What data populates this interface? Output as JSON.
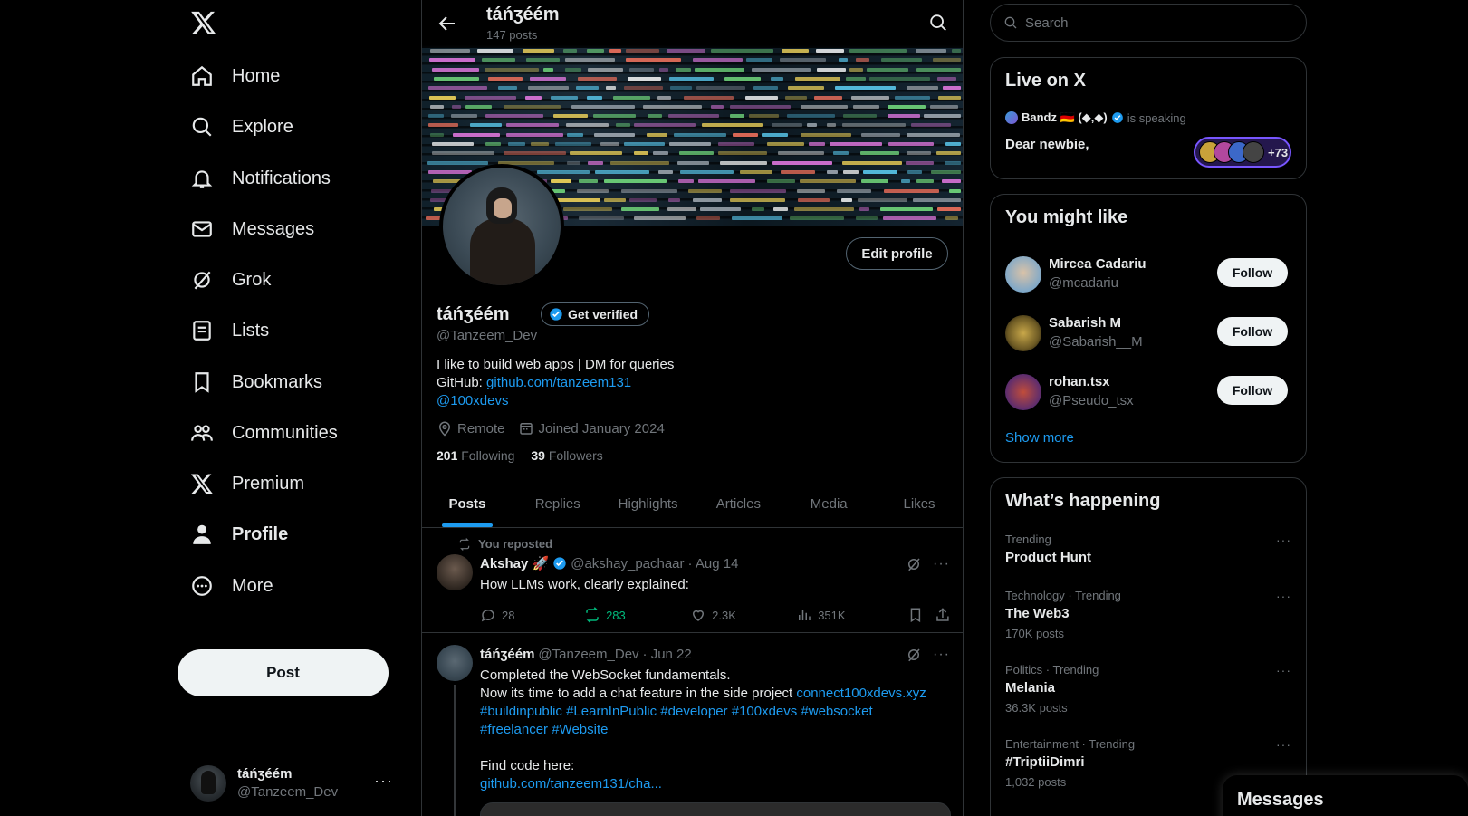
{
  "nav": {
    "items": [
      {
        "label": "Home",
        "icon": "home-icon"
      },
      {
        "label": "Explore",
        "icon": "search-icon"
      },
      {
        "label": "Notifications",
        "icon": "bell-icon"
      },
      {
        "label": "Messages",
        "icon": "mail-icon"
      },
      {
        "label": "Grok",
        "icon": "grok-icon"
      },
      {
        "label": "Lists",
        "icon": "list-icon"
      },
      {
        "label": "Bookmarks",
        "icon": "bookmark-icon"
      },
      {
        "label": "Communities",
        "icon": "communities-icon"
      },
      {
        "label": "Premium",
        "icon": "x-logo-icon"
      },
      {
        "label": "Profile",
        "icon": "person-icon"
      },
      {
        "label": "More",
        "icon": "more-circle-icon"
      }
    ],
    "post_label": "Post",
    "account": {
      "name": "táńʒéém",
      "handle": "@Tanzeem_Dev",
      "more": "···"
    }
  },
  "header": {
    "name": "táńʒéém",
    "post_count": "147 posts"
  },
  "profile": {
    "edit_label": "Edit profile",
    "name": "táńʒéém",
    "verify_label": "Get verified",
    "handle": "@Tanzeem_Dev",
    "bio_line1": "I like to build web apps | DM for queries",
    "bio_github_prefix": "GitHub: ",
    "bio_github_link": "github.com/tanzeem131",
    "bio_mention": "@100xdevs",
    "location": "Remote",
    "joined": "Joined January 2024",
    "following_count": "201",
    "following_label": "Following",
    "followers_count": "39",
    "followers_label": "Followers"
  },
  "tabs": [
    "Posts",
    "Replies",
    "Highlights",
    "Articles",
    "Media",
    "Likes"
  ],
  "tweets": [
    {
      "repost_label": "You reposted",
      "name": "Akshay 🚀",
      "handle": "@akshay_pachaar",
      "date": "· Aug 14",
      "text": "How LLMs work, clearly explained:",
      "replies": "28",
      "reposts": "283",
      "likes": "2.3K",
      "views": "351K"
    },
    {
      "name": "táńʒéém",
      "handle": "@Tanzeem_Dev",
      "date": "· Jun 22",
      "line1": "Completed the WebSocket fundamentals.",
      "line2_text": "Now its time to add a chat feature in the side project ",
      "line2_link": "connect100xdevs.xyz",
      "tags1": "#buildinpublic #LearnInPublic #developer #100xdevs #websocket",
      "tags2": "#freelancer #Website",
      "code_label": "Find code here:",
      "code_link": "github.com/tanzeem131/cha..."
    }
  ],
  "right": {
    "search_placeholder": "Search",
    "live": {
      "title": "Live on X",
      "speaker": "Bandz 🇩🇪 (◆,◆)",
      "speaking": "is speaking",
      "space_title": "Dear newbie,",
      "listeners": "+73"
    },
    "wtf": {
      "title": "You might like",
      "users": [
        {
          "name": "Mircea Cadariu",
          "handle": "@mcadariu",
          "follow": "Follow"
        },
        {
          "name": "Sabarish M",
          "handle": "@Sabarish__M",
          "follow": "Follow"
        },
        {
          "name": "rohan.tsx",
          "handle": "@Pseudo_tsx",
          "follow": "Follow"
        }
      ],
      "show_more": "Show more"
    },
    "trends": {
      "title": "What’s happening",
      "items": [
        {
          "context": "Trending",
          "title": "Product Hunt",
          "count": ""
        },
        {
          "context": "Technology · Trending",
          "title": "The Web3",
          "count": "170K posts"
        },
        {
          "context": "Politics · Trending",
          "title": "Melania",
          "count": "36.3K posts"
        },
        {
          "context": "Entertainment · Trending",
          "title": "#TriptiiDimri",
          "count": "1,032 posts"
        }
      ]
    }
  },
  "drawer": {
    "label": "Messages"
  },
  "colors": {
    "accent": "#1d9bf0",
    "repost_green": "#00ba7c",
    "border": "#2f3336",
    "muted": "#71767b"
  }
}
